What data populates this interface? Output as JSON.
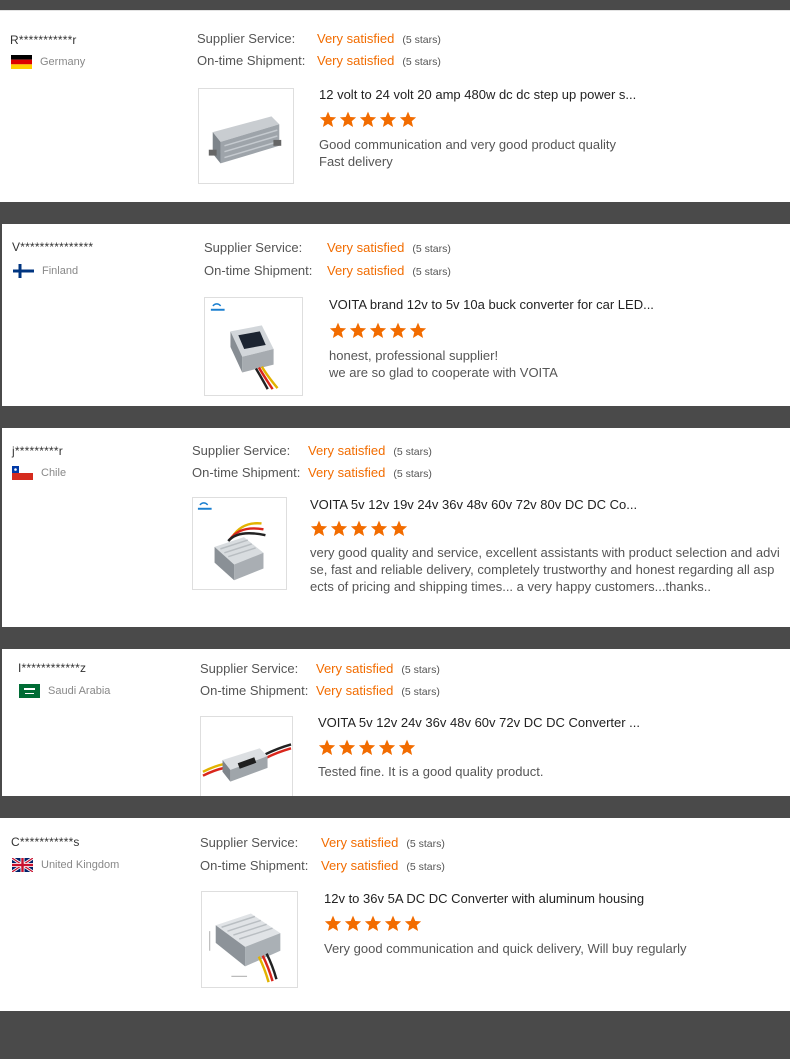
{
  "colors": {
    "background": "#4a4a4a",
    "accent_orange": "#f26c00",
    "card": "#ffffff",
    "text_gray": "#555555"
  },
  "labels": {
    "supplier_service": "Supplier Service:",
    "ontime_shipment": "On-time Shipment:"
  },
  "reviews": [
    {
      "name": "R***********r",
      "country": "Germany",
      "flag_icon": "germany-flag-icon",
      "supplier_service": "Very satisfied",
      "supplier_stars": "(5 stars)",
      "shipment": "Very satisfied",
      "shipment_stars": "(5 stars)",
      "product_title": "12 volt to 24 volt 20 amp 480w dc dc step up power s...",
      "rating_stars": 5,
      "comment_lines": [
        "Good communication and very good product quality",
        "Fast delivery"
      ]
    },
    {
      "name": "V***************",
      "country": "Finland",
      "flag_icon": "finland-flag-icon",
      "supplier_service": "Very satisfied",
      "supplier_stars": "(5 stars)",
      "shipment": "Very satisfied",
      "shipment_stars": "(5 stars)",
      "product_title": "VOITA brand 12v to 5v 10a buck converter for car LED...",
      "rating_stars": 5,
      "comment_lines": [
        "honest, professional supplier!",
        "we are so glad to cooperate with VOITA"
      ]
    },
    {
      "name": "j*********r",
      "country": "Chile",
      "flag_icon": "chile-flag-icon",
      "supplier_service": "Very satisfied",
      "supplier_stars": "(5 stars)",
      "shipment": "Very satisfied",
      "shipment_stars": "(5 stars)",
      "product_title": "VOITA 5v 12v 19v 24v 36v 48v 60v 72v 80v DC DC Co...",
      "rating_stars": 5,
      "comment_lines": [
        "very good quality and service, excellent assistants with product selection and advi",
        "se, fast and reliable delivery, completely trustworthy and honest regarding all asp",
        "ects of pricing and shipping times... a very happy customers...thanks.."
      ]
    },
    {
      "name": "I************z",
      "country": "Saudi Arabia",
      "flag_icon": "saudi-arabia-flag-icon",
      "supplier_service": "Very satisfied",
      "supplier_stars": "(5 stars)",
      "shipment": "Very satisfied",
      "shipment_stars": "(5 stars)",
      "product_title": "VOITA 5v 12v 24v 36v 48v 60v 72v DC DC Converter ...",
      "rating_stars": 5,
      "comment_lines": [
        "Tested fine. It is a good quality product."
      ]
    },
    {
      "name": "C***********s",
      "country": "United Kingdom",
      "flag_icon": "uk-flag-icon",
      "supplier_service": "Very satisfied",
      "supplier_stars": "(5 stars)",
      "shipment": "Very satisfied",
      "shipment_stars": "(5 stars)",
      "product_title": "12v to 36v 5A DC DC Converter with aluminum housing",
      "rating_stars": 5,
      "comment_lines": [
        "Very good communication and quick delivery, Will buy regularly"
      ]
    }
  ]
}
